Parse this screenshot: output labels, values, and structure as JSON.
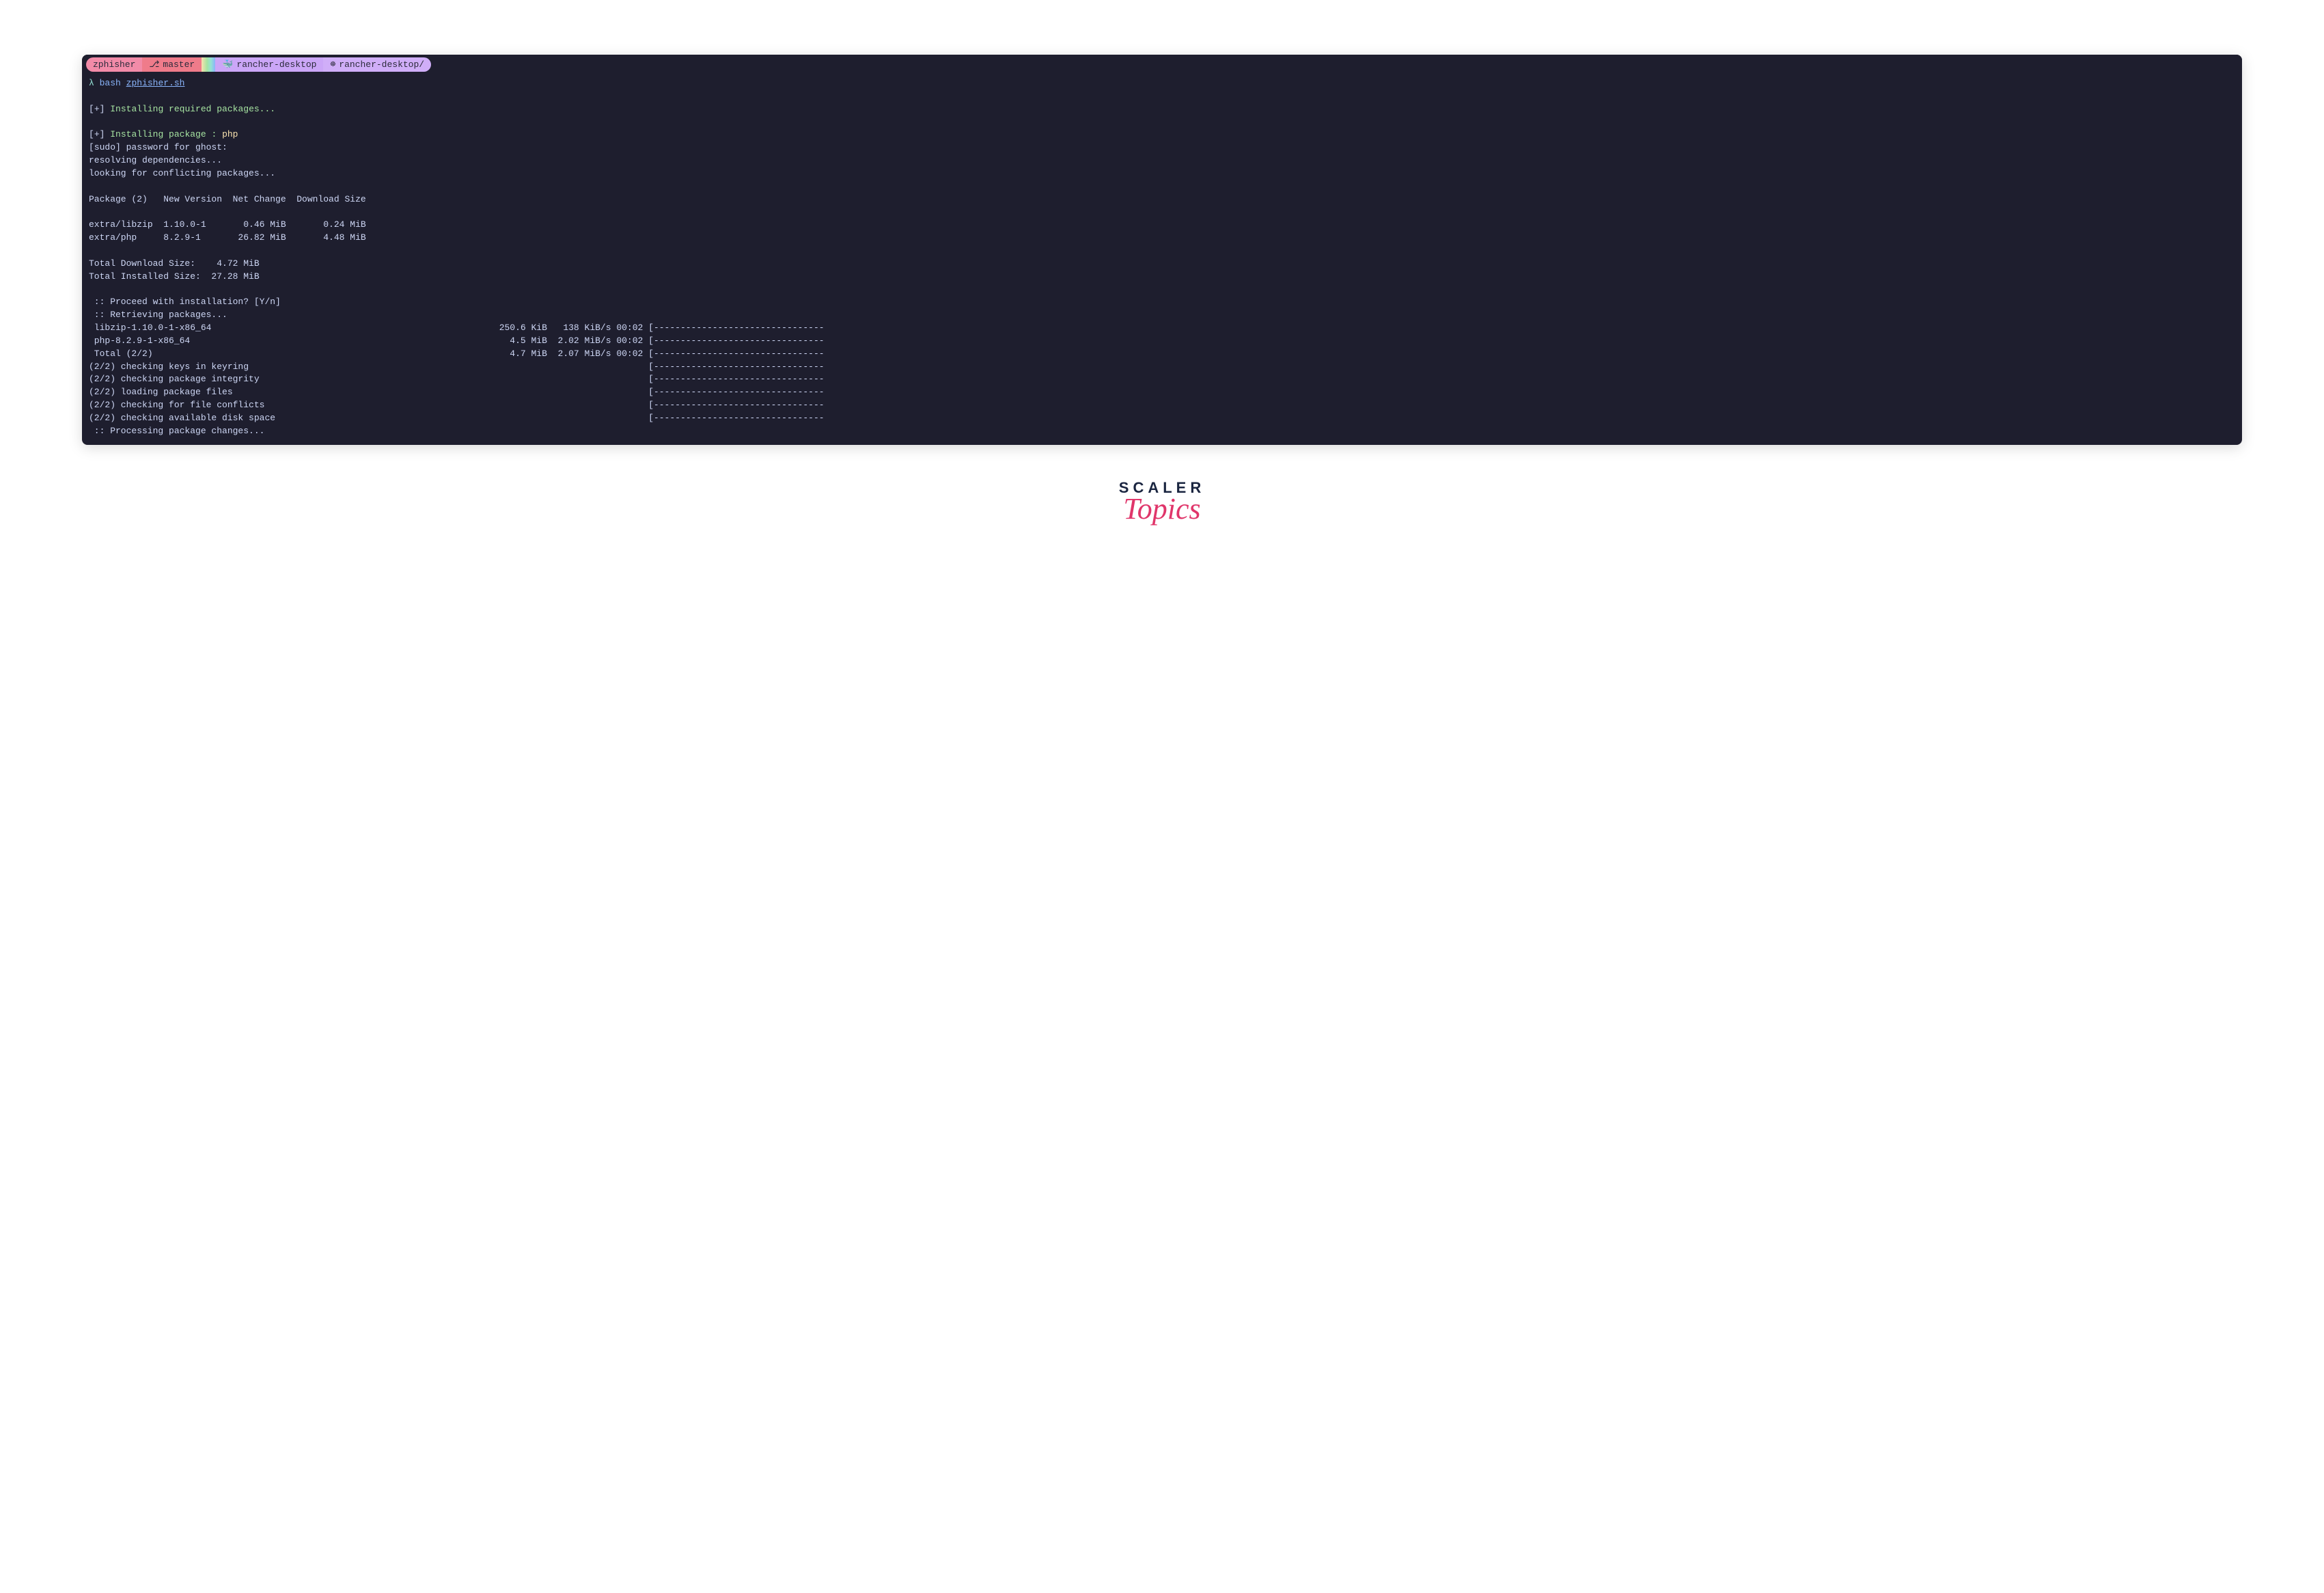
{
  "tabs": {
    "project": "zphisher",
    "branch_icon": "git-branch-icon",
    "branch": "master",
    "context1_icon": "docker-icon",
    "context1": "rancher-desktop",
    "context2_icon": "kube-icon",
    "context2": "rancher-desktop/"
  },
  "prompt": {
    "symbol": "λ",
    "command": "bash",
    "script": "zphisher.sh"
  },
  "lines": {
    "l1_bracket_open": "[",
    "l1_plus": "+",
    "l1_bracket_close": "] ",
    "l1_text": "Installing required packages...",
    "l2_bracket_open": "[",
    "l2_plus": "+",
    "l2_bracket_close": "] ",
    "l2_text": "Installing package : ",
    "l2_pkg": "php",
    "l3": "[sudo] password for ghost:",
    "l4": "resolving dependencies...",
    "l5": "looking for conflicting packages...",
    "l6": "Package (2)   New Version  Net Change  Download Size",
    "l7": "extra/libzip  1.10.0-1       0.46 MiB       0.24 MiB",
    "l8": "extra/php     8.2.9-1       26.82 MiB       4.48 MiB",
    "l9": "Total Download Size:    4.72 MiB",
    "l10": "Total Installed Size:  27.28 MiB",
    "l11": " :: Proceed with installation? [Y/n]",
    "l12": " :: Retrieving packages...",
    "l13": " libzip-1.10.0-1-x86_64                                                      250.6 KiB   138 KiB/s 00:02 [--------------------------------",
    "l14": " php-8.2.9-1-x86_64                                                            4.5 MiB  2.02 MiB/s 00:02 [--------------------------------",
    "l15": " Total (2/2)                                                                   4.7 MiB  2.07 MiB/s 00:02 [--------------------------------",
    "l16": "(2/2) checking keys in keyring                                                                           [--------------------------------",
    "l17": "(2/2) checking package integrity                                                                         [--------------------------------",
    "l18": "(2/2) loading package files                                                                              [--------------------------------",
    "l19": "(2/2) checking for file conflicts                                                                        [--------------------------------",
    "l20": "(2/2) checking available disk space                                                                      [--------------------------------",
    "l21": " :: Processing package changes..."
  },
  "brand": {
    "scaler": "SCALER",
    "topics": "Topics"
  }
}
